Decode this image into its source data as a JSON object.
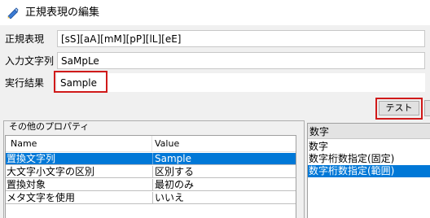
{
  "window": {
    "title": "正規表現の編集",
    "icon": "app-icon"
  },
  "fields": [
    {
      "label": "正規表現",
      "value": "[sS][aA][mM][pP][lL][eE]"
    },
    {
      "label": "入力文字列",
      "value": "SaMpLe"
    },
    {
      "label": "実行結果",
      "value": "Sample"
    }
  ],
  "test_button": {
    "label": "テスト"
  },
  "properties": {
    "group_title": "その他のプロパティ",
    "columns": [
      "Name",
      "Value"
    ],
    "rows": [
      {
        "name": "置換文字列",
        "value": "Sample",
        "selected": true
      },
      {
        "name": "大文字小文字の区別",
        "value": "区別する",
        "selected": false
      },
      {
        "name": "置換対象",
        "value": "最初のみ",
        "selected": false
      },
      {
        "name": "メタ文字を使用",
        "value": "いいえ",
        "selected": false
      }
    ]
  },
  "list": {
    "header": "数字",
    "items": [
      {
        "label": "数字",
        "selected": false
      },
      {
        "label": "数字桁数指定(固定)",
        "selected": false
      },
      {
        "label": "数字桁数指定(範囲)",
        "selected": true
      }
    ]
  },
  "colors": {
    "selection": "#0078d7",
    "highlight_box": "#d01a1a"
  }
}
